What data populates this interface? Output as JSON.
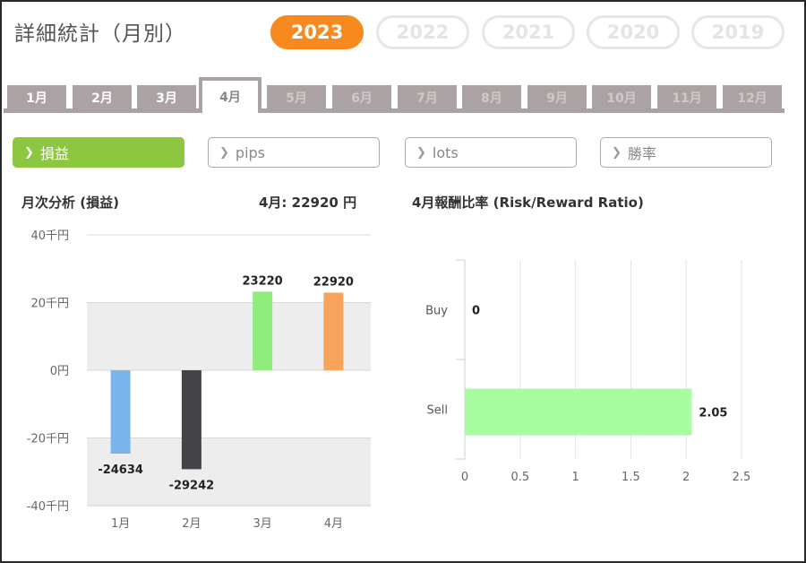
{
  "page": {
    "title": "詳細統計（月別）"
  },
  "years": [
    {
      "label": "2023",
      "active": true
    },
    {
      "label": "2022",
      "active": false
    },
    {
      "label": "2021",
      "active": false
    },
    {
      "label": "2020",
      "active": false
    },
    {
      "label": "2019",
      "active": false
    }
  ],
  "months": [
    {
      "label": "1月",
      "state": "enabled"
    },
    {
      "label": "2月",
      "state": "enabled"
    },
    {
      "label": "3月",
      "state": "enabled"
    },
    {
      "label": "4月",
      "state": "active"
    },
    {
      "label": "5月",
      "state": "disabled"
    },
    {
      "label": "6月",
      "state": "disabled"
    },
    {
      "label": "7月",
      "state": "disabled"
    },
    {
      "label": "8月",
      "state": "disabled"
    },
    {
      "label": "9月",
      "state": "disabled"
    },
    {
      "label": "10月",
      "state": "disabled"
    },
    {
      "label": "11月",
      "state": "disabled"
    },
    {
      "label": "12月",
      "state": "disabled"
    }
  ],
  "metrics": [
    {
      "label": "損益",
      "active": true
    },
    {
      "label": "pips",
      "active": false
    },
    {
      "label": "lots",
      "active": false
    },
    {
      "label": "勝率",
      "active": false
    }
  ],
  "monthly": {
    "title": "月次分析 (損益)",
    "summary": "4月:  22920 円"
  },
  "ratio": {
    "title": "4月報酬比率 (Risk/Reward Ratio)"
  },
  "colors": {
    "accent": "#f7891f",
    "active_metric": "#8dc63f",
    "tab_gray": "#aba2a3"
  },
  "chart_data": [
    {
      "type": "bar",
      "title": "月次分析 (損益)",
      "categories": [
        "1月",
        "2月",
        "3月",
        "4月"
      ],
      "values": [
        -24634,
        -29242,
        23220,
        22920
      ],
      "colors": [
        "#7cb5ec",
        "#434348",
        "#90ed7d",
        "#f7a35c"
      ],
      "data_labels": [
        "-24634",
        "-29242",
        "23220",
        "22920"
      ],
      "ylim": [
        -40000,
        40000
      ],
      "yticks": [
        40000,
        20000,
        0,
        -20000,
        -40000
      ],
      "ytick_labels": [
        "40千円",
        "20千円",
        "0円",
        "-20千円",
        "-40千円"
      ],
      "grid": true
    },
    {
      "type": "bar",
      "orientation": "horizontal",
      "title": "4月報酬比率 (Risk/Reward Ratio)",
      "categories": [
        "Buy",
        "Sell"
      ],
      "values": [
        0,
        2.05
      ],
      "data_labels": [
        "0",
        "2.05"
      ],
      "color": "#a7fda0",
      "xlim": [
        0,
        2.5
      ],
      "xticks": [
        0,
        0.5,
        1,
        1.5,
        2,
        2.5
      ],
      "xtick_labels": [
        "0",
        "0.5",
        "1",
        "1.5",
        "2",
        "2.5"
      ],
      "grid": true
    }
  ]
}
